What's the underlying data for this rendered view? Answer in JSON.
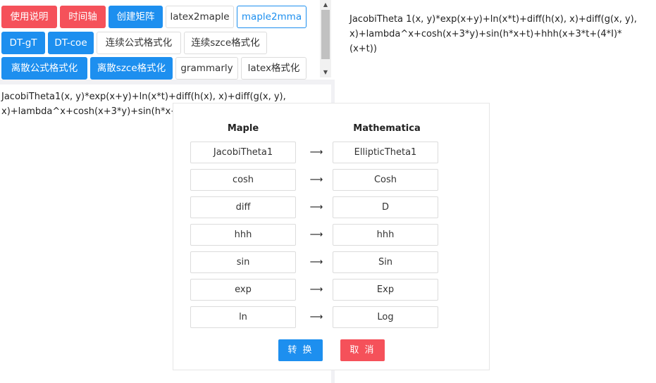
{
  "toolbar": {
    "buttons": [
      {
        "label": "使用说明"
      },
      {
        "label": "时间轴"
      },
      {
        "label": "创建矩阵"
      },
      {
        "label": "latex2maple"
      },
      {
        "label": "maple2mma"
      },
      {
        "label": "DT-gT"
      },
      {
        "label": "DT-coe"
      },
      {
        "label": "连续公式格式化"
      },
      {
        "label": "连续szce格式化"
      },
      {
        "label": "离散公式格式化"
      },
      {
        "label": "离散szce格式化"
      },
      {
        "label": "grammarly"
      },
      {
        "label": "latex格式化"
      }
    ]
  },
  "input": {
    "text": "JacobiTheta1(x, y)*exp(x+y)+ln(x*t)+diff(h(x), x)+diff(g(x, y), x)+lambda^x+cosh(x+3*y)+sin(h*x+t)+hhh(x+3*t+(4*I)*(x+t))"
  },
  "output": {
    "text": "JacobiTheta 1(x, y)*exp(x+y)+ln(x*t)+diff(h(x), x)+diff(g(x, y), x)+lambda^x+cosh(x+3*y)+sin(h*x+t)+hhh(x+3*t+(4*I)*(x+t))"
  },
  "dialog": {
    "col_left": "Maple",
    "col_right": "Mathematica",
    "arrow": "⟶",
    "rows": [
      {
        "maple": "JacobiTheta1",
        "mma": "EllipticTheta1"
      },
      {
        "maple": "cosh",
        "mma": "Cosh"
      },
      {
        "maple": "diff",
        "mma": "D"
      },
      {
        "maple": "hhh",
        "mma": "hhh"
      },
      {
        "maple": "sin",
        "mma": "Sin"
      },
      {
        "maple": "exp",
        "mma": "Exp"
      },
      {
        "maple": "ln",
        "mma": "Log"
      }
    ],
    "ok_label": "转 换",
    "cancel_label": "取 消"
  },
  "colors": {
    "blue": "#1d8fef",
    "red": "#f5515a"
  }
}
